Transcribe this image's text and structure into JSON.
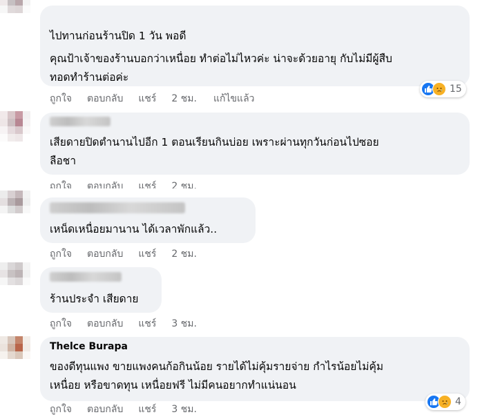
{
  "comments": [
    {
      "author": "",
      "lines": [
        "ไปทานก่อนร้านปิด 1 วัน พอดี",
        "คุณป้าเจ้าของร้านบอกว่าเหนื่อย ทำต่อไม่ไหวค่ะ น่าจะด้วยอายุ กับไม่มีผู้สืบ",
        "ทอดทำร้านต่อค่ะ"
      ],
      "actions": {
        "like": "ถูกใจ",
        "reply": "ตอบกลับ",
        "share": "แชร์",
        "time": "2 ชม.",
        "edited": "แก้ไขแล้ว"
      },
      "reactions": {
        "icons": [
          "like-icon",
          "sad-icon"
        ],
        "count": "15"
      }
    },
    {
      "author": "",
      "lines": [
        "เสียดายปิดตำนานไปอีก 1 ตอนเรียนกินบ่อย เพราะผ่านทุกวันก่อนไปซอย",
        "ลือชา"
      ],
      "actions": {
        "like": "ถูกใจ",
        "reply": "ตอบกลับ",
        "share": "แชร์",
        "time": "2 ชม."
      }
    },
    {
      "author": "",
      "lines": [
        "เหน็ดเหนื่อยมานาน ได้เวลาพักแล้ว.."
      ],
      "actions": {
        "like": "ถูกใจ",
        "reply": "ตอบกลับ",
        "share": "แชร์",
        "time": "2 ชม."
      }
    },
    {
      "author": "",
      "lines": [
        "ร้านประจำ เสียดาย"
      ],
      "actions": {
        "like": "ถูกใจ",
        "reply": "ตอบกลับ",
        "share": "แชร์",
        "time": "3 ชม."
      }
    },
    {
      "author": "Thelce Burapa",
      "lines": [
        "ของดีทุนแพง ขายแพงคนก้อกินน้อย รายได้ไม่คุ้มรายจ่าย กำไรน้อยไม่คุ้ม",
        "เหนื่อย หรือขาดทุน เหนื่อยฟรี ไม่มีคนอยากทำแน่นอน"
      ],
      "actions": {
        "like": "ถูกใจ",
        "reply": "ตอบกลับ",
        "share": "แชร์",
        "time": "3 ชม."
      },
      "reactions": {
        "icons": [
          "like-icon",
          "sad-icon"
        ],
        "count": "4"
      }
    }
  ],
  "colors": {
    "bubble": "#f0f2f5",
    "meta": "#65676b",
    "like": "#1877f2",
    "sad": "#f7b125"
  }
}
